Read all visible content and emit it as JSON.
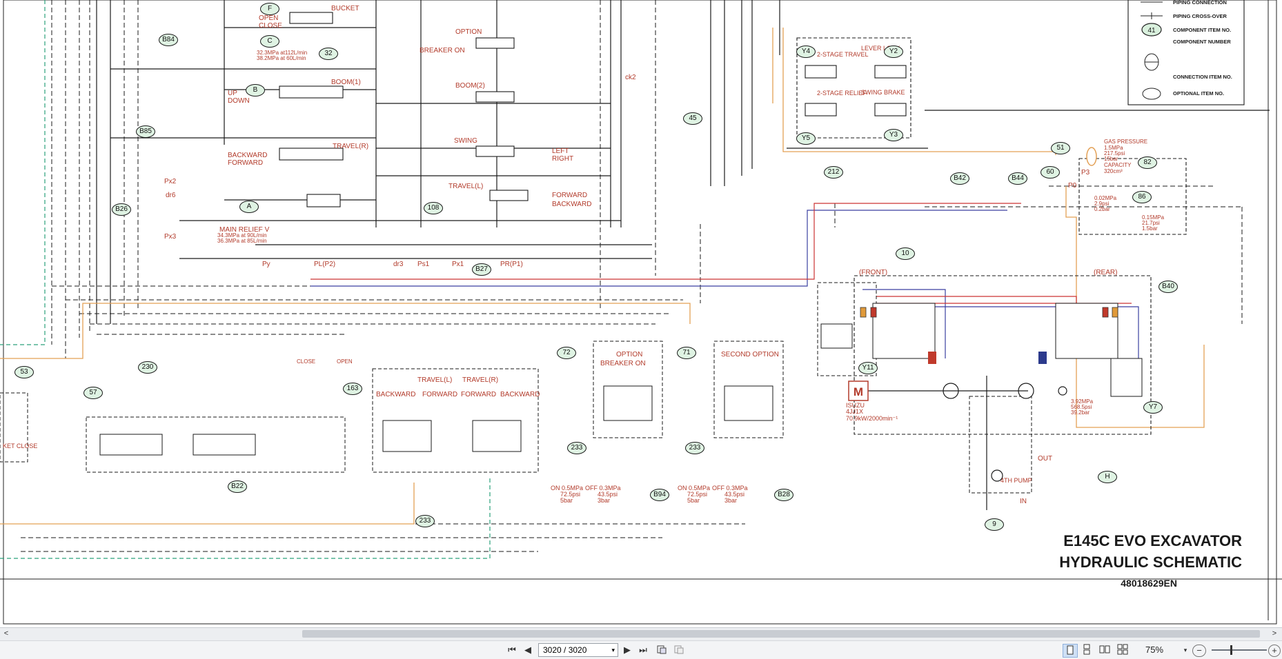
{
  "drawing": {
    "title_line1": "E145C EVO EXCAVATOR",
    "title_line2": "HYDRAULIC SCHEMATIC",
    "doc_number": "48018629EN",
    "legend": {
      "piping_connection": "PIPING CONNECTION",
      "piping_crossover": "PIPING CROSS-OVER",
      "component_item": "COMPONENT ITEM NO.",
      "component_number": "COMPONENT NUMBER",
      "connection_item": "CONNECTION ITEM NO.",
      "optional_item": "OPTIONAL ITEM NO.",
      "sample_id": "41"
    },
    "labels": {
      "bucket": "BUCKET",
      "open": "OPEN",
      "close": "CLOSE",
      "option": "OPTION",
      "breaker_on": "BREAKER ON",
      "boom2": "BOOM(2)",
      "boom1": "BOOM(1)",
      "up": "UP",
      "down": "DOWN",
      "swing": "SWING",
      "left": "LEFT",
      "right": "RIGHT",
      "backward": "BACKWARD",
      "forward": "FORWARD",
      "travel_r": "TRAVEL(R)",
      "travel_l": "TRAVEL(L)",
      "main_relief": "MAIN RELIEF V",
      "relief_1": "34.3MPa at 90L/min",
      "relief_2": "36.3MPa at 85L/min",
      "pressure_1": "32.3MPa at112L/min",
      "pressure_2": "38.2MPa at 60L/min",
      "pl_p2": "PL(P2)",
      "pr_p1": "PR(P1)",
      "dr3": "dr3",
      "ps1": "Ps1",
      "px1": "Px1",
      "py": "Py",
      "px2": "Px2",
      "px3": "Px3",
      "dr6": "dr6",
      "ck2": "ck2",
      "two_stage_travel": "2-STAGE TRAVEL",
      "lever_lock": "LEVER LOCK",
      "two_stage_relief": "2-STAGE RELIEF",
      "swing_brake": "SWING BRAKE",
      "gas_pressure": "GAS PRESSURE",
      "gp1": "1.5MPa",
      "gp2": "217.5psi",
      "gp3": "15bar",
      "capacity": "CAPACITY",
      "cap_val": "320cm³",
      "p3": "P3",
      "p0": "P0",
      "v002_1": "0.02MPa",
      "v002_2": "2.9psi",
      "v002_3": "0.2bar",
      "v015_1": "0.15MPa",
      "v015_2": "21.7psi",
      "v015_3": "1.5bar",
      "front": "(FRONT)",
      "rear": "(REAR)",
      "engine": "ISUZU",
      "engine_model": "4JJ1X",
      "engine_power": "70.9kW/2000min⁻¹",
      "fourth_pump": "4TH PUMP",
      "out": "OUT",
      "in": "IN",
      "v392_1": "3.92MPa",
      "v392_2": "568.5psi",
      "v392_3": "39.2bar",
      "second_option": "SECOND OPTION",
      "breaker_on_2": "BREAKER ON",
      "on05": "ON 0.5MPa",
      "on_psi": "72.5psi",
      "on_bar": "5bar",
      "off03": "OFF 0.3MPa",
      "off_psi": "43.5psi",
      "off_bar": "3bar",
      "close_lbl": "CLOSE",
      "open_lbl": "OPEN",
      "ket_close": "KET CLOSE",
      "m": "M"
    },
    "circled_items": [
      "F",
      "C",
      "32",
      "B84",
      "B",
      "B85",
      "A",
      "108",
      "B26",
      "B27",
      "45",
      "Y4",
      "Y2",
      "Y5",
      "Y3",
      "212",
      "51",
      "60",
      "82",
      "86",
      "B42",
      "B44",
      "10",
      "B40",
      "Y11",
      "Y7",
      "H",
      "9",
      "163",
      "230",
      "57",
      "53",
      "72",
      "71",
      "233",
      "233",
      "233",
      "B94",
      "B28",
      "B22"
    ]
  },
  "scrollbar": {
    "left_arrow": "<",
    "right_arrow": ">"
  },
  "toolbar": {
    "first_page": "⏮",
    "prev_page": "◀",
    "page_value": "3020 / 3020",
    "page_dropdown": "▾",
    "next_page": "▶",
    "last_page": "⏭",
    "zoom_value": "75%",
    "zoom_dropdown": "▾",
    "zoom_out": "−",
    "zoom_in": "+"
  }
}
